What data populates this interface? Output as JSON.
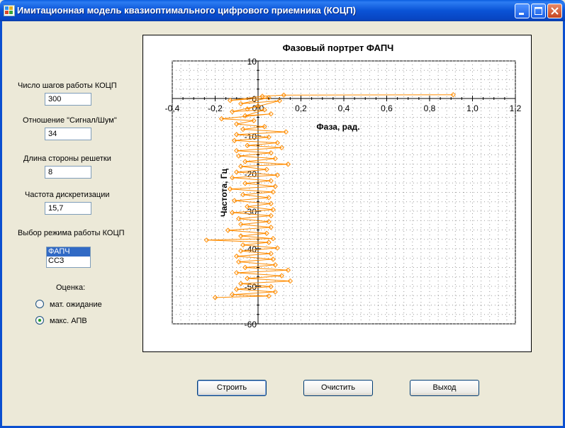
{
  "window": {
    "title": "Имитационная модель квазиоптимального цифрового приемника (КОЦП)"
  },
  "form": {
    "steps_label": "Число шагов работы КОЦП",
    "steps_value": "300",
    "snr_label": "Отношение \"Сигнал/Шум\"",
    "snr_value": "34",
    "grid_label": "Длина стороны решетки",
    "grid_value": "8",
    "freq_label": "Частота дискретизации",
    "freq_value": "15,7",
    "mode_label": "Выбор режима работы КОЦП",
    "mode_options": [
      "ФАПЧ",
      "ССЗ"
    ],
    "mode_selected": "ФАПЧ",
    "estimate_label": "Оценка:",
    "radio_mean": "мат. ожидание",
    "radio_max": "макс. АПВ",
    "radio_selected": "макс. АПВ"
  },
  "buttons": {
    "build": "Строить",
    "clear": "Очистить",
    "exit": "Выход"
  },
  "chart_data": {
    "type": "line",
    "title": "Фазовый портрет ФАПЧ",
    "xlabel": "Фаза, рад.",
    "ylabel": "Частота, Гц",
    "xlim": [
      -0.4,
      1.2
    ],
    "ylim": [
      -60,
      10
    ],
    "x_ticks": [
      "-0,4",
      "-0,2",
      "0,0",
      "0,2",
      "0,4",
      "0,6",
      "0,8",
      "1,0",
      "1,2"
    ],
    "y_ticks": [
      "10",
      "0",
      "-10",
      "-20",
      "-30",
      "-40",
      "-50",
      "-60"
    ],
    "grid": true,
    "color": "#ff8c00",
    "points": [
      [
        0.91,
        1.0
      ],
      [
        0.12,
        0.9
      ],
      [
        0.02,
        0.6
      ],
      [
        -0.13,
        -0.5
      ],
      [
        0.05,
        0.2
      ],
      [
        -0.08,
        -1.4
      ],
      [
        0.1,
        -0.6
      ],
      [
        -0.05,
        -2.8
      ],
      [
        0.0,
        -2.0
      ],
      [
        -0.12,
        -3.5
      ],
      [
        0.03,
        -3.0
      ],
      [
        -0.06,
        -4.6
      ],
      [
        0.06,
        -4.1
      ],
      [
        -0.17,
        -5.4
      ],
      [
        -0.02,
        -5.9
      ],
      [
        -0.1,
        -6.8
      ],
      [
        0.03,
        -7.5
      ],
      [
        -0.07,
        -8.2
      ],
      [
        0.13,
        -8.9
      ],
      [
        -0.1,
        -9.6
      ],
      [
        0.05,
        -10.3
      ],
      [
        -0.11,
        -11.2
      ],
      [
        0.09,
        -11.8
      ],
      [
        -0.05,
        -12.5
      ],
      [
        0.11,
        -13.1
      ],
      [
        -0.1,
        -13.9
      ],
      [
        0.06,
        -14.5
      ],
      [
        -0.09,
        -15.3
      ],
      [
        0.08,
        -16.0
      ],
      [
        -0.06,
        -16.8
      ],
      [
        0.14,
        -17.5
      ],
      [
        -0.08,
        -18.1
      ],
      [
        0.04,
        -18.9
      ],
      [
        -0.1,
        -19.6
      ],
      [
        0.09,
        -20.4
      ],
      [
        -0.12,
        -21.1
      ],
      [
        0.06,
        -21.9
      ],
      [
        -0.06,
        -22.6
      ],
      [
        0.08,
        -23.4
      ],
      [
        -0.13,
        -24.1
      ],
      [
        0.07,
        -24.9
      ],
      [
        -0.07,
        -25.6
      ],
      [
        0.05,
        -26.4
      ],
      [
        -0.11,
        -27.2
      ],
      [
        0.06,
        -28.0
      ],
      [
        -0.05,
        -28.8
      ],
      [
        0.07,
        -29.6
      ],
      [
        -0.12,
        -30.4
      ],
      [
        0.06,
        -31.2
      ],
      [
        -0.09,
        -32.0
      ],
      [
        0.05,
        -32.8
      ],
      [
        -0.08,
        -33.5
      ],
      [
        0.06,
        -34.3
      ],
      [
        -0.14,
        -35.1
      ],
      [
        0.04,
        -35.9
      ],
      [
        -0.08,
        -36.6
      ],
      [
        0.07,
        -37.3
      ],
      [
        -0.24,
        -37.7
      ],
      [
        0.05,
        -38.3
      ],
      [
        -0.07,
        -39.0
      ],
      [
        0.09,
        -39.8
      ],
      [
        -0.08,
        -40.6
      ],
      [
        0.06,
        -41.3
      ],
      [
        -0.1,
        -42.0
      ],
      [
        0.07,
        -42.8
      ],
      [
        -0.09,
        -43.5
      ],
      [
        0.08,
        -44.3
      ],
      [
        -0.06,
        -45.0
      ],
      [
        0.14,
        -45.7
      ],
      [
        -0.1,
        -46.4
      ],
      [
        0.11,
        -47.2
      ],
      [
        -0.05,
        -47.9
      ],
      [
        0.15,
        -48.6
      ],
      [
        -0.08,
        -49.3
      ],
      [
        0.06,
        -50.1
      ],
      [
        -0.1,
        -50.8
      ],
      [
        0.08,
        -51.5
      ],
      [
        -0.12,
        -52.2
      ],
      [
        0.05,
        -52.6
      ],
      [
        -0.2,
        -53.0
      ]
    ]
  }
}
